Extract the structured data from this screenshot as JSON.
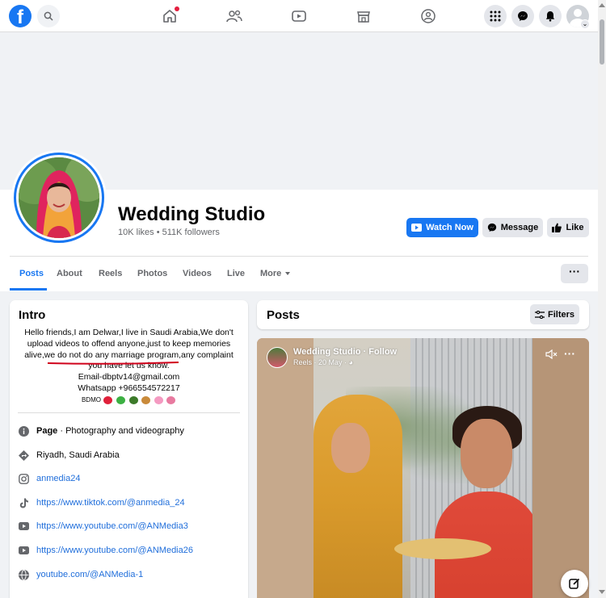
{
  "nav": {
    "logo": "f",
    "icons": [
      "home-icon",
      "friends-icon",
      "watch-icon",
      "marketplace-icon",
      "groups-icon"
    ],
    "right_icons": [
      "menu-grid-icon",
      "messenger-icon",
      "notifications-icon",
      "account-avatar"
    ]
  },
  "page": {
    "name": "Wedding Studio",
    "stats": "10K likes • 511K followers"
  },
  "actions": {
    "watch_now": "Watch Now",
    "message": "Message",
    "like": "Like"
  },
  "tabs": [
    {
      "label": "Posts",
      "active": true
    },
    {
      "label": "About"
    },
    {
      "label": "Reels"
    },
    {
      "label": "Photos"
    },
    {
      "label": "Videos"
    },
    {
      "label": "Live"
    },
    {
      "label": "More"
    }
  ],
  "intro": {
    "title": "Intro",
    "bio_lines": [
      "Hello friends,I am Delwar,I live in Saudi Arabia,We don't",
      "upload videos to offend anyone,just to keep memories",
      "alive,we do not do any marriage program,any complaint",
      "you have let us know.",
      "Email-dbptv14@gmail.com",
      "Whatsapp +966554572217"
    ],
    "bdmo": "BDMO",
    "details": [
      {
        "icon": "info-icon",
        "bold": "Page",
        "text": " · Photography and videography"
      },
      {
        "icon": "location-icon",
        "text": "Riyadh, Saudi Arabia"
      },
      {
        "icon": "instagram-icon",
        "text": "anmedia24",
        "link": true
      },
      {
        "icon": "tiktok-icon",
        "text": "https://www.tiktok.com/@anmedia_24",
        "link": true
      },
      {
        "icon": "youtube-icon",
        "text": "https://www.youtube.com/@ANMedia3",
        "link": true
      },
      {
        "icon": "youtube-icon",
        "text": "https://www.youtube.com/@ANMedia26",
        "link": true
      },
      {
        "icon": "globe-icon",
        "text": "youtube.com/@ANMedia-1",
        "link": true
      }
    ]
  },
  "posts": {
    "title": "Posts",
    "filters": "Filters",
    "reel": {
      "author": "Wedding Studio · Follow",
      "meta": "Reels · 20 May ·"
    }
  },
  "colors": {
    "brand": "#1877f2",
    "link": "#216fdb",
    "bio_underline": "#d0021b"
  }
}
